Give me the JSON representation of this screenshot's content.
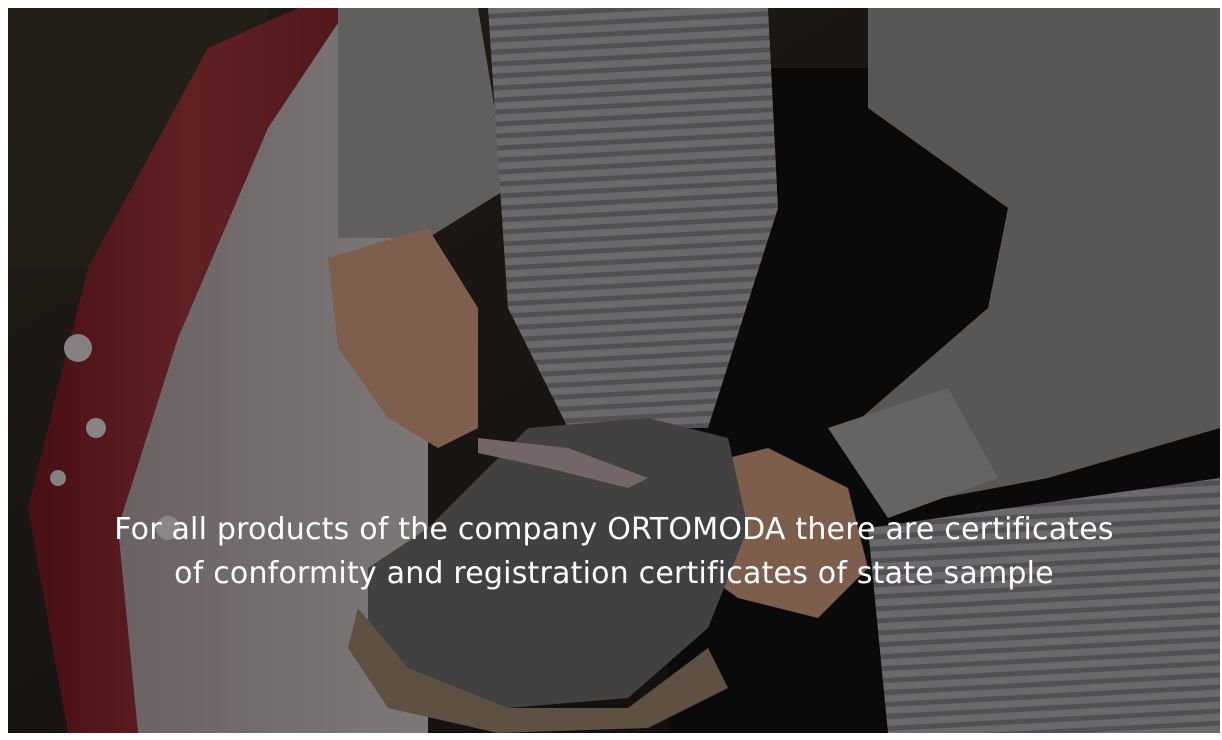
{
  "banner": {
    "caption_line1": "For all products of the company ORTOMODA there are certificates",
    "caption_line2": "of conformity and registration certificates of state sample",
    "image_subject": "child-tying-shoelace-on-slide"
  },
  "colors": {
    "overlay": "#000000",
    "caption_text": "#ffffff",
    "slide_red": "#8a2a2c",
    "sweater_grey": "#8c8a88",
    "leg_stripes": "#b8b4b6",
    "shoe_grey": "#6e6a68",
    "sole_beige": "#8e7a62"
  }
}
